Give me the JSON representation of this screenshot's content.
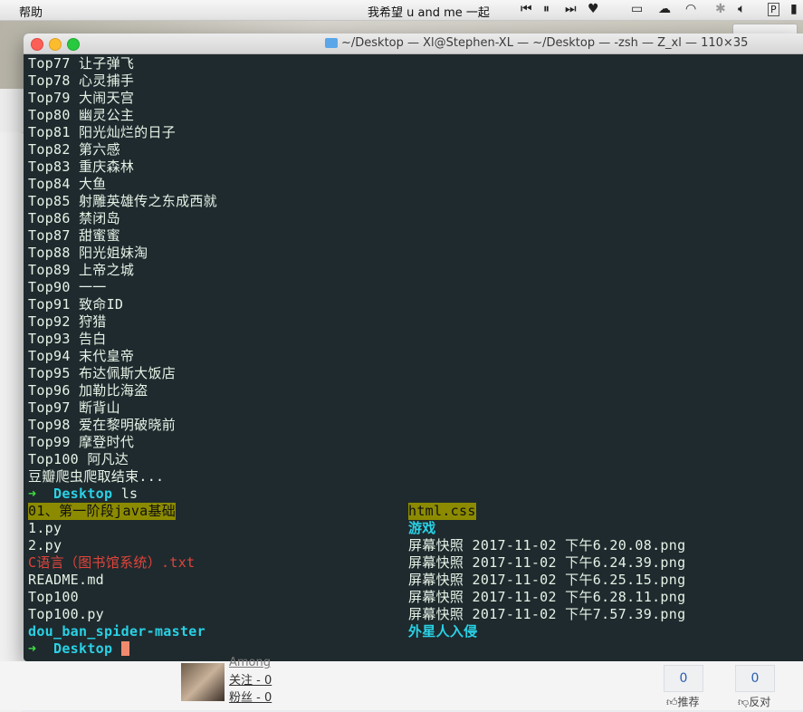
{
  "menubar": {
    "help_menu": "帮助",
    "now_playing": "我希望 u and me 一起"
  },
  "terminal": {
    "title": "~/Desktop — Xl@Stephen-XL — ~/Desktop — -zsh — Z_xl — 110×35",
    "lines": [
      "Top77 让子弹飞",
      "Top78 心灵捕手",
      "Top79 大闹天宫",
      "Top80 幽灵公主",
      "Top81 阳光灿烂的日子",
      "Top82 第六感",
      "Top83 重庆森林",
      "Top84 大鱼",
      "Top85 射雕英雄传之东成西就",
      "Top86 禁闭岛",
      "Top87 甜蜜蜜",
      "Top88 阳光姐妹淘",
      "Top89 上帝之城",
      "Top90 一一",
      "Top91 致命ID",
      "Top92 狩猎",
      "Top93 告白",
      "Top94 末代皇帝",
      "Top95 布达佩斯大饭店",
      "Top96 加勒比海盗",
      "Top97 断背山",
      "Top98 爱在黎明破晓前",
      "Top99 摩登时代",
      "Top100 阿凡达",
      "豆瓣爬虫爬取结束..."
    ],
    "prompt_arrow": "➜",
    "prompt_dir": "Desktop",
    "command": "ls",
    "ls_left": [
      "01、第一阶段java基础",
      "1.py",
      "2.py",
      "C语言（图书馆系统）.txt",
      "README.md",
      "Top100",
      "Top100.py",
      "dou_ban_spider-master"
    ],
    "ls_right": [
      "html.css",
      "游戏",
      "屏幕快照 2017-11-02 下午6.20.08.png",
      "屏幕快照 2017-11-02 下午6.24.39.png",
      "屏幕快照 2017-11-02 下午6.25.15.png",
      "屏幕快照 2017-11-02 下午6.28.11.png",
      "屏幕快照 2017-11-02 下午7.57.39.png",
      "外星人入侵"
    ]
  },
  "footer": {
    "user_name": "Among",
    "follow": "关注 - 0",
    "fans": "粉丝 - 0",
    "recommend_count": "0",
    "recommend_label": "推荐",
    "oppose_count": "0",
    "oppose_label": "反对"
  },
  "colors": {
    "terminal_bg": "#1f2a2e",
    "terminal_fg": "#e6f2e6",
    "dir_cyan": "#29d2e6",
    "prompt_green": "#3ee03e",
    "highlight_bg": "#8c8b00",
    "red_file": "#e0443a"
  }
}
